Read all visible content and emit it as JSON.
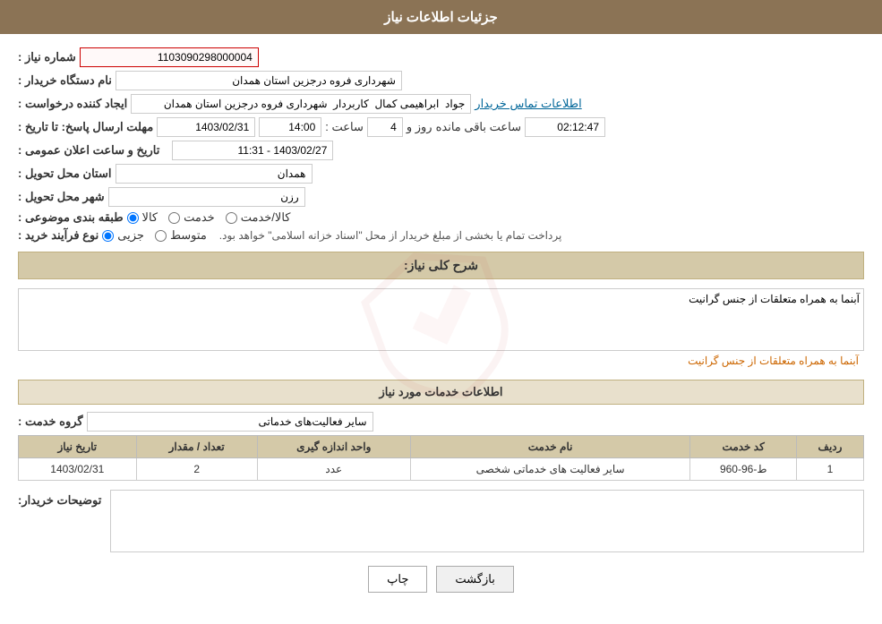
{
  "header": {
    "title": "جزئیات اطلاعات نیاز"
  },
  "fields": {
    "shomara_niaz_label": "شماره نیاز :",
    "shomara_niaz_value": "1103090298000004",
    "nam_dastgah_label": "نام دستگاه خریدار :",
    "nam_dastgah_value": "شهرداری فروه درجزین استان همدان",
    "ijad_konande_label": "ایجاد کننده درخواست :",
    "ijad_konande_value": "جواد  ابراهیمی کمال  کاربردار  شهرداری فروه درجزین استان همدان",
    "ettelaat_tamas_link": "اطلاعات تماس خریدار",
    "mohlat_ersal_label": "مهلت ارسال پاسخ: تا تاریخ :",
    "mohlat_date": "1403/02/31",
    "mohlat_saat_label": "ساعت :",
    "mohlat_saat_value": "14:00",
    "mohlat_roz_label": "روز و",
    "mohlat_roz_value": "4",
    "mohlat_mande_value": "02:12:47",
    "mohlat_mande_label": "ساعت باقی مانده",
    "tarikh_label": "تاریخ و ساعت اعلان عمومی :",
    "tarikh_value": "1403/02/27 - 11:31",
    "ostan_label": "استان محل تحویل :",
    "ostan_value": "همدان",
    "shahr_label": "شهر محل تحویل :",
    "shahr_value": "رزن",
    "tabaqe_label": "طبقه بندی موضوعی :",
    "radio_kala": "کالا",
    "radio_khedmat": "خدمت",
    "radio_kala_khedmat": "کالا/خدمت",
    "nav_farband_label": "نوع فرآیند خرید :",
    "radio_jozi": "جزیی",
    "radio_motosat": "متوسط",
    "nav_desc": "پرداخت تمام یا بخشی از مبلغ خریدار از محل \"اسناد خزانه اسلامی\" خواهد بود.",
    "sharh_label": "شرح کلی نیاز:",
    "sharh_value": "آبنما به همراه متعلقات از جنس گرانیت",
    "khadamat_label": "اطلاعات خدمات مورد نیاز",
    "gorooh_label": "گروه خدمت :",
    "gorooh_value": "سایر فعالیت‌های خدماتی",
    "table": {
      "headers": [
        "ردیف",
        "کد خدمت",
        "نام خدمت",
        "واحد اندازه گیری",
        "تعداد / مقدار",
        "تاریخ نیاز"
      ],
      "rows": [
        {
          "radif": "1",
          "kod_khedmat": "ط-96-960",
          "nam_khedmat": "سایر فعالیت های خدماتی شخصی",
          "vahed": "عدد",
          "tedad": "2",
          "tarikh": "1403/02/31"
        }
      ]
    },
    "tosif_label": "توضیحات خریدار:",
    "tosif_value": "",
    "btn_chap": "چاپ",
    "btn_bazgasht": "بازگشت"
  }
}
